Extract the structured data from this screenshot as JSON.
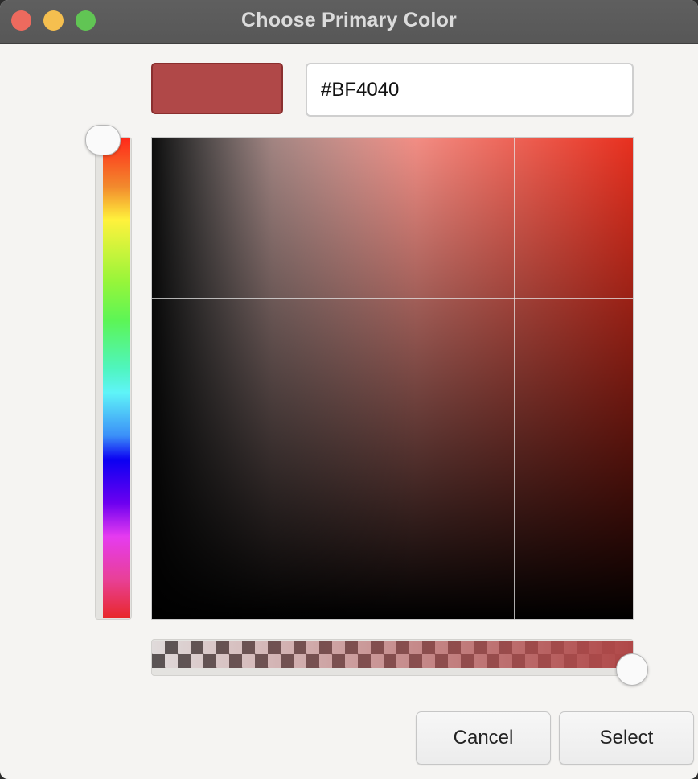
{
  "window": {
    "title": "Choose Primary Color"
  },
  "color": {
    "hex_value": "#BF4040",
    "swatch_color": "#B04848",
    "hue_color": "#E8301F",
    "alpha": 1.0
  },
  "buttons": {
    "cancel_label": "Cancel",
    "select_label": "Select"
  }
}
